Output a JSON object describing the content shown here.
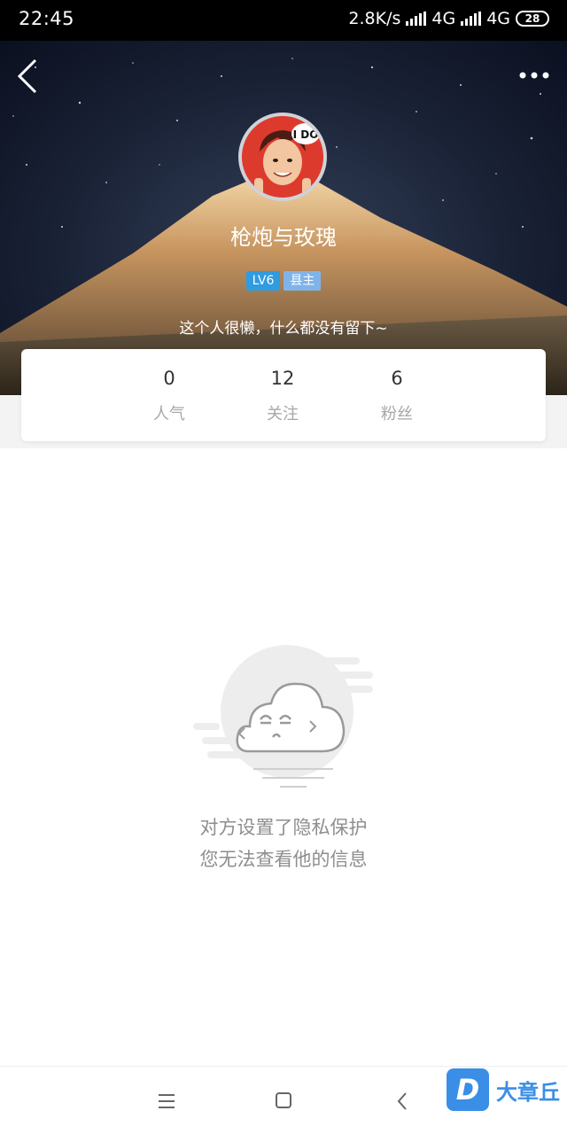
{
  "status_bar": {
    "time": "22:45",
    "speed": "2.8K/s",
    "net1": "4G",
    "net2": "4G",
    "battery": "28"
  },
  "header": {
    "back_icon": "chevron-left-icon",
    "more_icon": "more-horizontal-icon"
  },
  "profile": {
    "avatar_text": "I DO",
    "username": "枪炮与玫瑰",
    "level_badge": "LV6",
    "title_badge": "县主",
    "bio": "这个人很懒，什么都没有留下~",
    "badge_colors": {
      "level": "#2f9be0",
      "title": "#7fb4ea"
    }
  },
  "stats": [
    {
      "value": "0",
      "label": "人气"
    },
    {
      "value": "12",
      "label": "关注"
    },
    {
      "value": "6",
      "label": "粉丝"
    }
  ],
  "empty_state": {
    "icon": "cloud-empty-icon",
    "line1": "对方设置了隐私保护",
    "line2": "您无法查看他的信息"
  },
  "nav": {
    "menu_icon": "menu-icon",
    "home_icon": "home-square-icon",
    "back_icon": "back-triangle-icon"
  },
  "watermark": {
    "logo": "D",
    "text": "大章丘"
  }
}
